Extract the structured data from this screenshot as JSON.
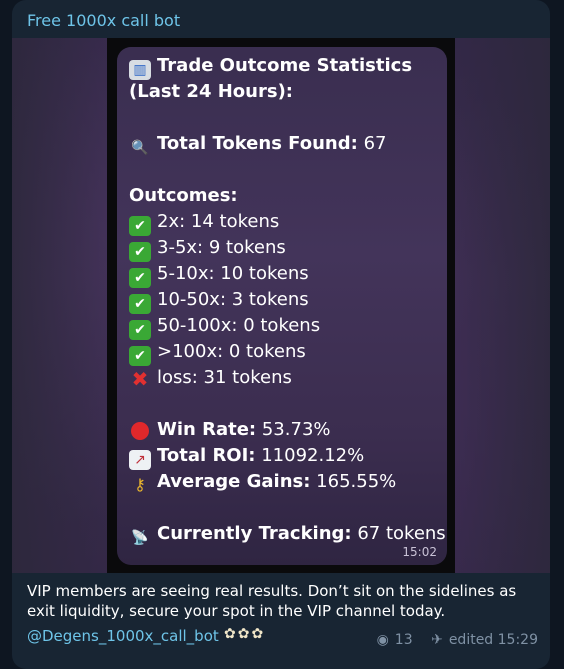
{
  "sender": "Free 1000x call bot",
  "card": {
    "title1": "Trade Outcome Statistics",
    "title2": "(Last 24 Hours):",
    "tokens_found_label": "Total Tokens Found:",
    "tokens_found_value": "67",
    "outcomes_label": "Outcomes:",
    "outcomes": [
      "2x: 14 tokens",
      "3-5x: 9 tokens",
      "5-10x: 10 tokens",
      "10-50x: 3 tokens",
      "50-100x: 0 tokens",
      ">100x: 0 tokens"
    ],
    "loss": "loss: 31 tokens",
    "win_rate_label": "Win Rate:",
    "win_rate_value": "53.73%",
    "roi_label": "Total ROI:",
    "roi_value": "11092.12%",
    "avg_label": "Average Gains:",
    "avg_value": "165.55%",
    "tracking_label": "Currently Tracking:",
    "tracking_value": "67 tokens",
    "time": "15:02",
    "icons": {
      "chart": "bar-chart-icon",
      "magnifier": "magnifier-icon",
      "check": "check-mark-icon",
      "cross": "cross-mark-icon",
      "circle": "red-circle-icon",
      "trend": "trend-up-icon",
      "key": "key-icon",
      "dish": "satellite-dish-icon"
    }
  },
  "caption": "VIP members are seeing real results. Don’t sit on the sidelines as exit liquidity, secure your spot in the VIP channel today.",
  "link": "@Degens_1000x_call_bot",
  "views": "13",
  "edited": "edited 15:29",
  "colors": {
    "sender": "#6ec4e8",
    "bubble": "#182533",
    "check": "#3aa835",
    "cross": "#e23030"
  }
}
